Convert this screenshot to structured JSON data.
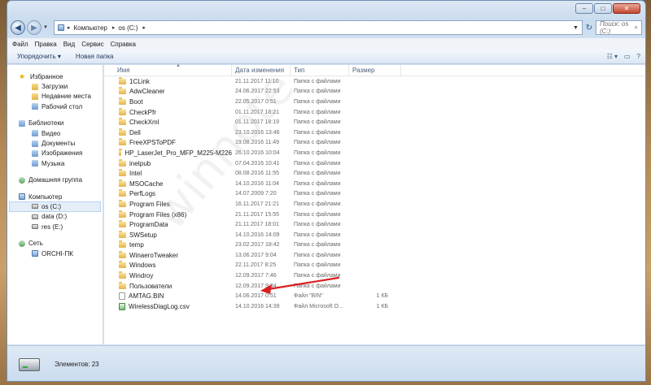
{
  "address": {
    "segments": [
      "Компьютер",
      "os (C:)"
    ],
    "search_placeholder": "Поиск: os (C:)"
  },
  "menu": [
    "Файл",
    "Правка",
    "Вид",
    "Сервис",
    "Справка"
  ],
  "toolbar": {
    "organize": "Упорядочить ▾",
    "new_folder": "Новая папка"
  },
  "nav": {
    "favorites": {
      "label": "Избранное",
      "items": [
        "Загрузки",
        "Недавние места",
        "Рабочий стол"
      ]
    },
    "libraries": {
      "label": "Библиотеки",
      "items": [
        "Видео",
        "Документы",
        "Изображения",
        "Музыка"
      ]
    },
    "homegroup": "Домашняя группа",
    "computer": {
      "label": "Компьютер",
      "items": [
        "os (C:)",
        "data (D:)",
        "res (E:)"
      ]
    },
    "network": {
      "label": "Сеть",
      "items": [
        "ORCHI-ПК"
      ]
    }
  },
  "columns": {
    "name": "Имя",
    "date": "Дата изменения",
    "type": "Тип",
    "size": "Размер"
  },
  "files": [
    {
      "name": "1CLink",
      "date": "21.11.2017 11:10",
      "type": "Папка с файлами",
      "size": "",
      "icon": "folder"
    },
    {
      "name": "AdwCleaner",
      "date": "24.06.2017 22:53",
      "type": "Папка с файлами",
      "size": "",
      "icon": "folder"
    },
    {
      "name": "Boot",
      "date": "22.05.2017 0:51",
      "type": "Папка с файлами",
      "size": "",
      "icon": "folder"
    },
    {
      "name": "CheckPfr",
      "date": "01.11.2017 18:21",
      "type": "Папка с файлами",
      "size": "",
      "icon": "folder"
    },
    {
      "name": "CheckXml",
      "date": "01.11.2017 18:19",
      "type": "Папка с файлами",
      "size": "",
      "icon": "folder"
    },
    {
      "name": "Dell",
      "date": "23.10.2016 13:46",
      "type": "Папка с файлами",
      "size": "",
      "icon": "folder"
    },
    {
      "name": "FreeXPSToPDF",
      "date": "19.08.2016 11:49",
      "type": "Папка с файлами",
      "size": "",
      "icon": "folder"
    },
    {
      "name": "HP_LaserJet_Pro_MFP_M225-M226",
      "date": "26.10.2016 10:04",
      "type": "Папка с файлами",
      "size": "",
      "icon": "folder"
    },
    {
      "name": "inetpub",
      "date": "07.04.2016 10:41",
      "type": "Папка с файлами",
      "size": "",
      "icon": "folder"
    },
    {
      "name": "Intel",
      "date": "08.08.2016 11:55",
      "type": "Папка с файлами",
      "size": "",
      "icon": "folder"
    },
    {
      "name": "MSOCache",
      "date": "14.10.2016 11:04",
      "type": "Папка с файлами",
      "size": "",
      "icon": "folder"
    },
    {
      "name": "PerfLogs",
      "date": "14.07.2009 7:20",
      "type": "Папка с файлами",
      "size": "",
      "icon": "folder"
    },
    {
      "name": "Program Files",
      "date": "16.11.2017 21:21",
      "type": "Папка с файлами",
      "size": "",
      "icon": "folder"
    },
    {
      "name": "Program Files (x86)",
      "date": "21.11.2017 15:55",
      "type": "Папка с файлами",
      "size": "",
      "icon": "folder"
    },
    {
      "name": "ProgramData",
      "date": "21.11.2017 18:01",
      "type": "Папка с файлами",
      "size": "",
      "icon": "folder"
    },
    {
      "name": "SWSetup",
      "date": "14.10.2016 14:09",
      "type": "Папка с файлами",
      "size": "",
      "icon": "folder"
    },
    {
      "name": "temp",
      "date": "23.02.2017 18:42",
      "type": "Папка с файлами",
      "size": "",
      "icon": "folder"
    },
    {
      "name": "WinaeroTweaker",
      "date": "13.06.2017 9:04",
      "type": "Папка с файлами",
      "size": "",
      "icon": "folder"
    },
    {
      "name": "Windows",
      "date": "22.11.2017 8:25",
      "type": "Папка с файлами",
      "size": "",
      "icon": "folder"
    },
    {
      "name": "Windroy",
      "date": "12.09.2017 7:46",
      "type": "Папка с файлами",
      "size": "",
      "icon": "folder"
    },
    {
      "name": "Пользователи",
      "date": "12.09.2017 9:34",
      "type": "Папка с файлами",
      "size": "",
      "icon": "folder"
    },
    {
      "name": "AMTAG.BIN",
      "date": "14.06.2017 0:51",
      "type": "Файл \"BIN\"",
      "size": "1 КБ",
      "icon": "bin"
    },
    {
      "name": "WirelessDiagLog.csv",
      "date": "14.10.2016 14:39",
      "type": "Файл Microsoft O...",
      "size": "1 КБ",
      "icon": "csv"
    }
  ],
  "status": {
    "count": "Элементов: 23"
  },
  "watermark": "winnote"
}
